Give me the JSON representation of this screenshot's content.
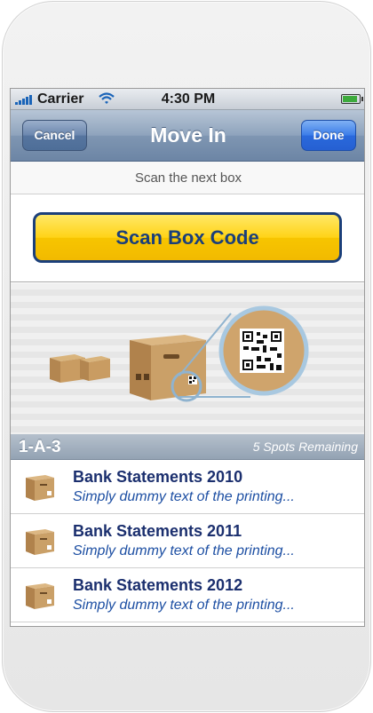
{
  "status": {
    "carrier": "Carrier",
    "time": "4:30 PM"
  },
  "nav": {
    "title": "Move In",
    "cancel_label": "Cancel",
    "done_label": "Done"
  },
  "prompt": "Scan the next box",
  "scan_button_label": "Scan Box Code",
  "section": {
    "code": "1-A-3",
    "remaining": "5 Spots Remaining"
  },
  "items": [
    {
      "title": "Bank Statements 2010",
      "subtitle": "Simply dummy text of the printing..."
    },
    {
      "title": "Bank Statements 2011",
      "subtitle": "Simply dummy text of the printing..."
    },
    {
      "title": "Bank Statements 2012",
      "subtitle": "Simply dummy text of the printing..."
    }
  ],
  "colors": {
    "nav": "#8ea3bc",
    "accent_yellow": "#ffd317",
    "navy": "#1b3f7a",
    "done_blue": "#2a69dc"
  },
  "icons": [
    "signal-icon",
    "wifi-icon",
    "battery-icon",
    "box-icon",
    "qr-code-icon"
  ]
}
